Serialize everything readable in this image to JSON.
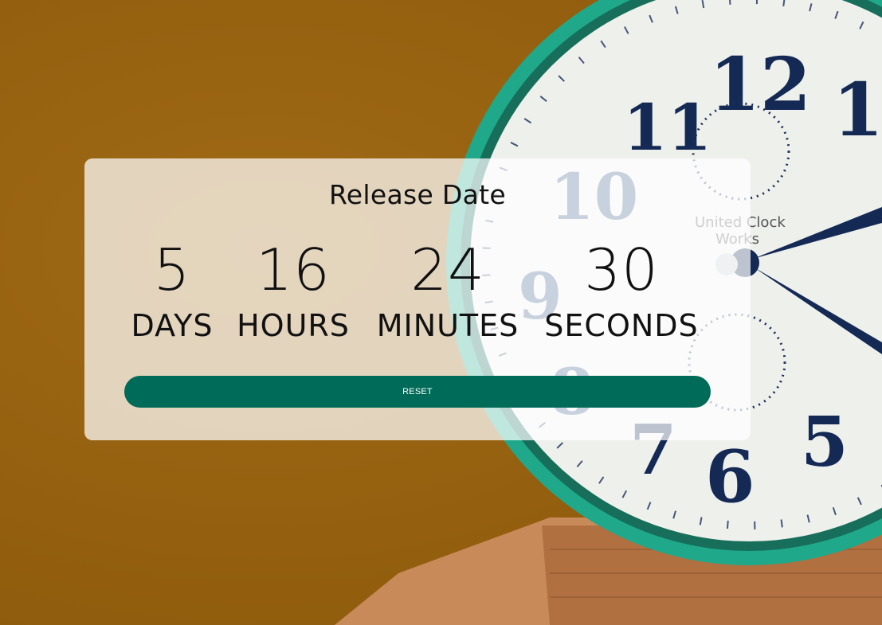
{
  "card": {
    "title": "Release Date"
  },
  "countdown": [
    {
      "value": "5",
      "label": "DAYS"
    },
    {
      "value": "16",
      "label": "HOURS"
    },
    {
      "value": "24",
      "label": "MINUTES"
    },
    {
      "value": "30",
      "label": "SECONDS"
    }
  ],
  "reset_button": {
    "label": "RESET"
  },
  "background": {
    "clock_brand": "United Clock Works",
    "colors": {
      "backdrop": "#9a6414",
      "clock_rim": "#1fa88a",
      "clock_face": "#eef0ec",
      "numerals": "#142a55"
    }
  },
  "colors": {
    "button": "#006b58",
    "card": "rgba(255,255,255,0.72)"
  }
}
